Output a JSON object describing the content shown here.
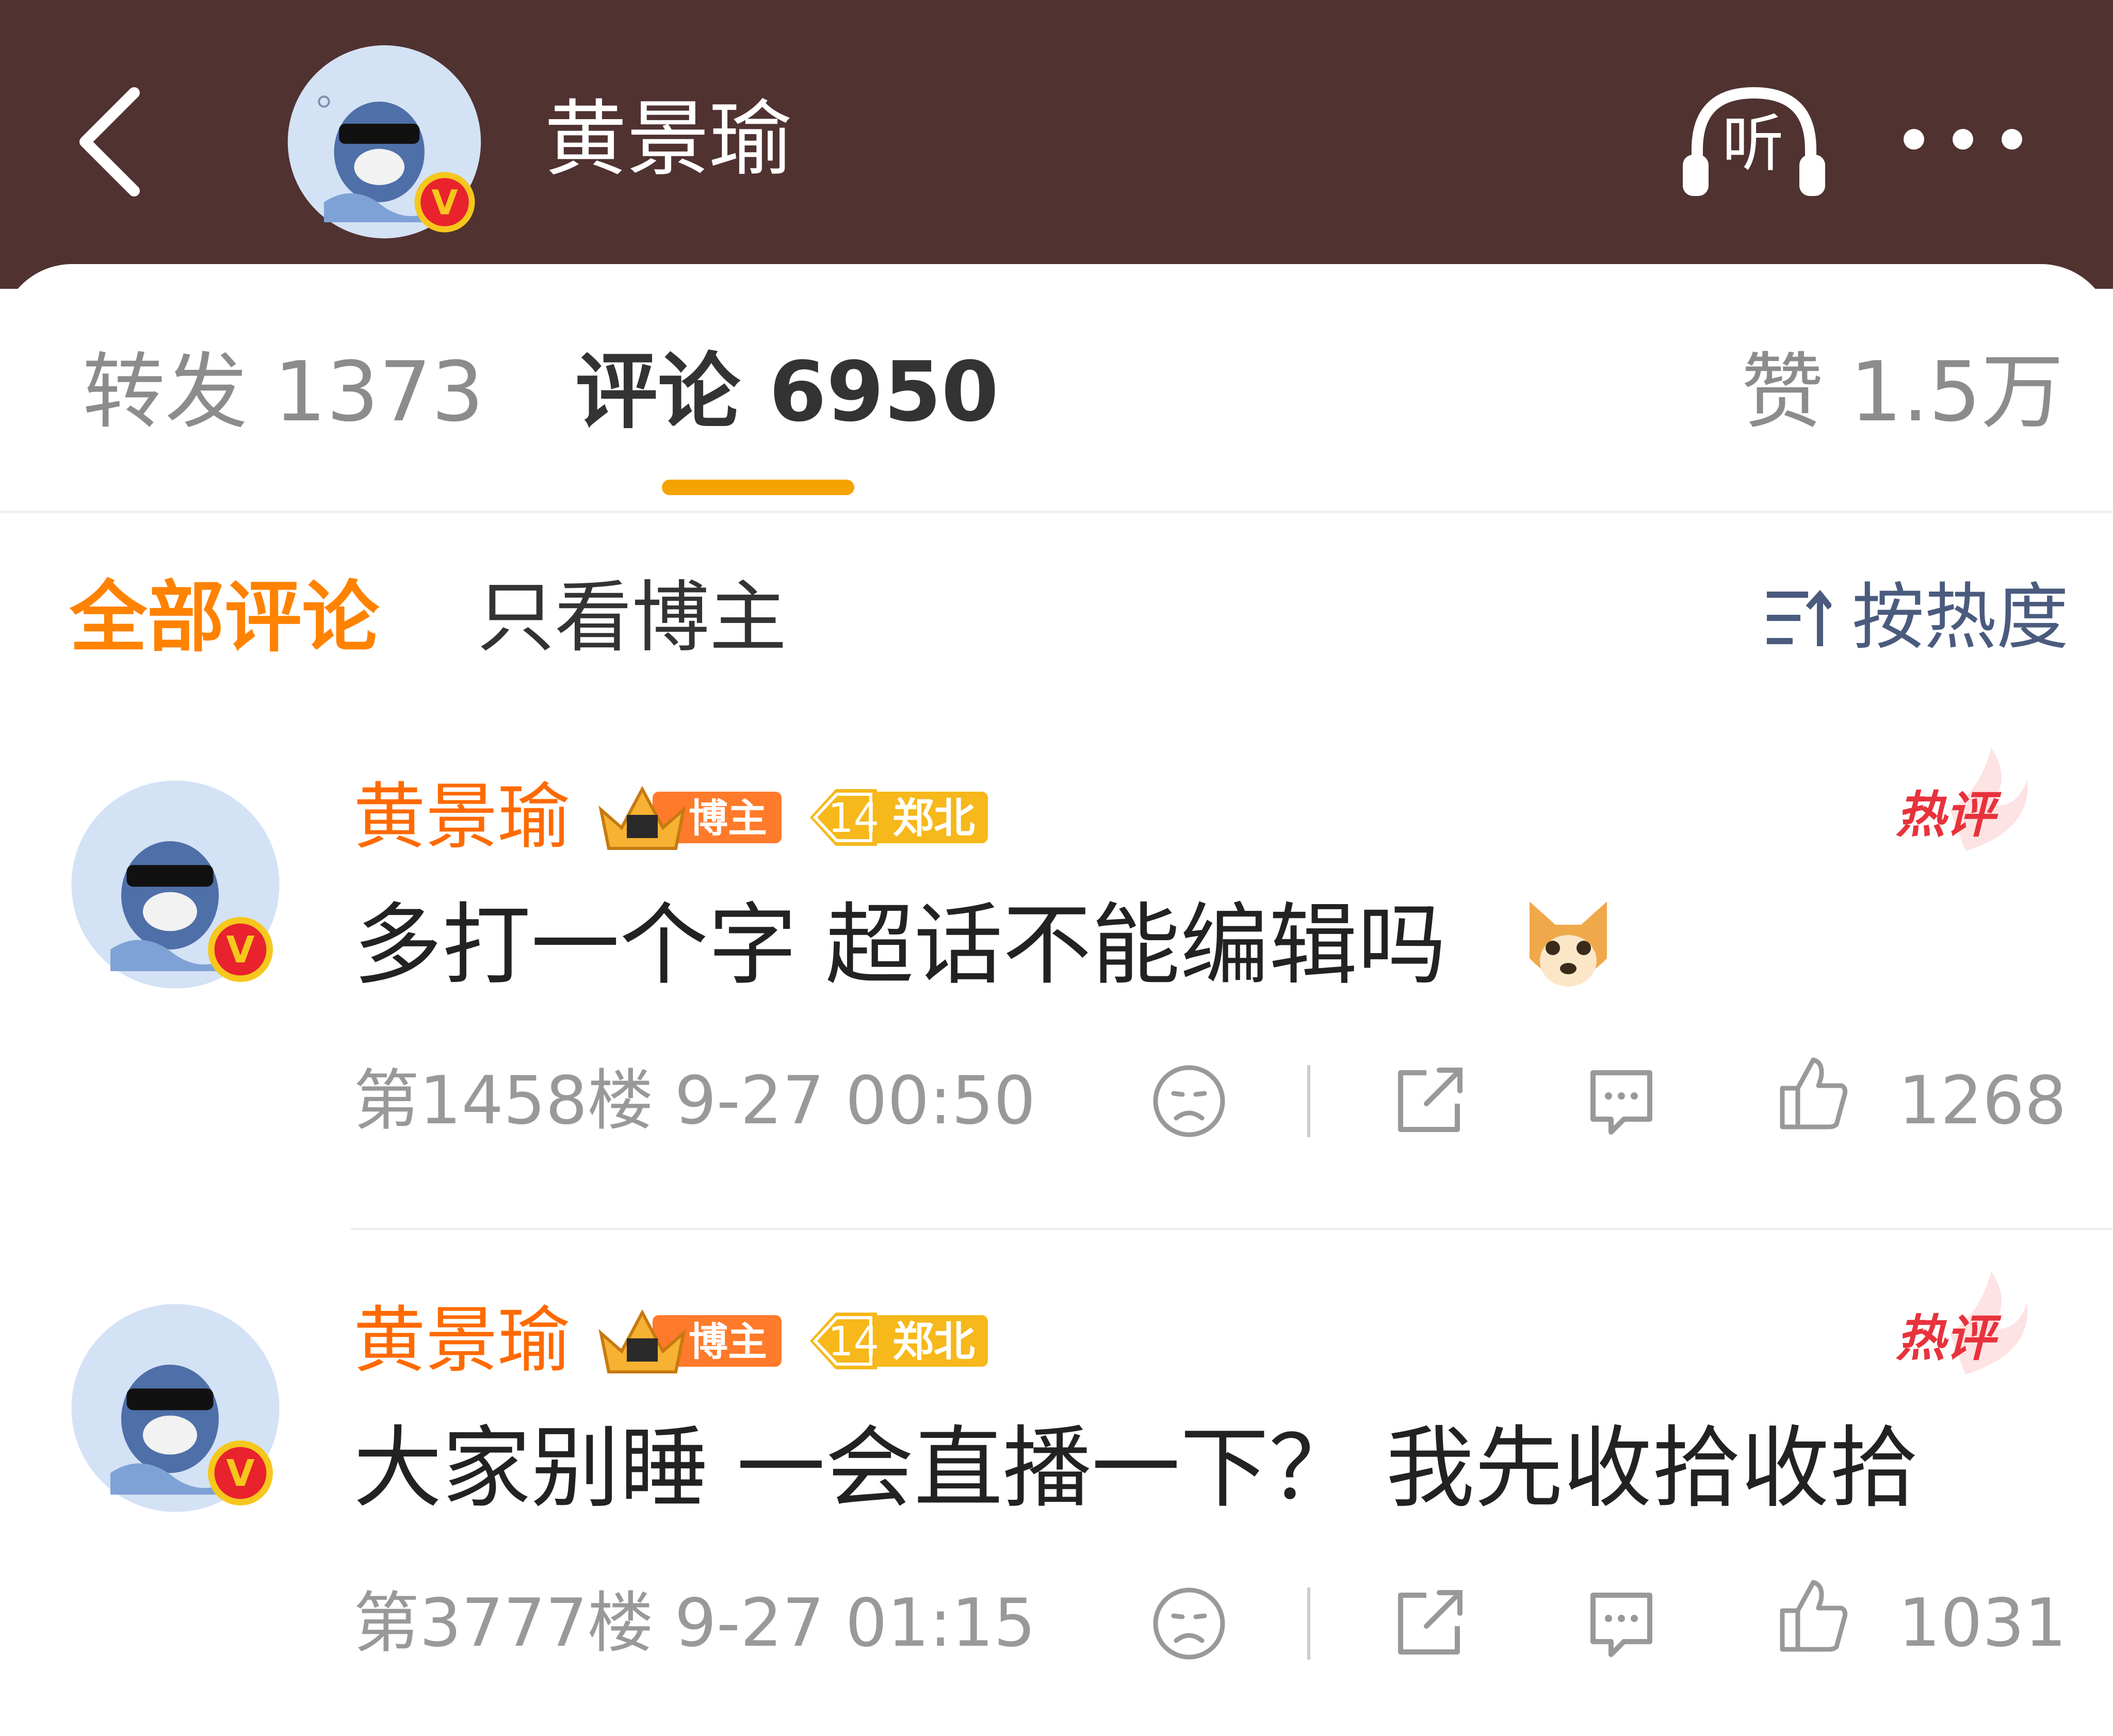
{
  "header": {
    "title": "黄景瑜",
    "listen_label": "听"
  },
  "tabs": [
    {
      "label": "转发 1373"
    },
    {
      "label": "评论 6950"
    },
    {
      "label": "赞 1.5万"
    }
  ],
  "filters": {
    "all": "全部评论",
    "blogger_only": "只看博主",
    "sort": "按热度"
  },
  "colors": {
    "header_bg": "#503231",
    "accent_orange": "#ff8200",
    "username_orange": "#ff6a00",
    "tab_indicator": "#f5a300",
    "hot_red": "#e8323c",
    "sort_blue": "#4a5b7e"
  },
  "comments": [
    {
      "username": "黄景瑜",
      "blogger_badge": "博主",
      "level": "14",
      "location": "郑北",
      "hot_label": "热评",
      "text": "多打一个字 超话不能编辑吗",
      "emoji": "dog-face-icon",
      "meta": "第1458楼 9-27 00:50",
      "likes": "1268"
    },
    {
      "username": "黄景瑜",
      "blogger_badge": "博主",
      "level": "14",
      "location": "郑北",
      "hot_label": "热评",
      "text": "大家别睡 一会直播一下？ 我先收拾收拾",
      "meta": "第3777楼 9-27 01:15",
      "likes": "1031"
    }
  ],
  "icons": [
    "back-arrow-icon",
    "headphones-icon",
    "more-icon",
    "sort-icon",
    "verified-v-icon",
    "crown-icon",
    "dislike-face-icon",
    "share-icon",
    "reply-icon",
    "thumbs-up-icon"
  ]
}
